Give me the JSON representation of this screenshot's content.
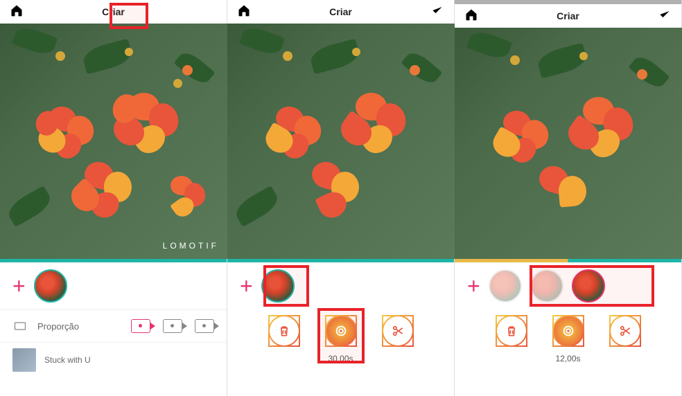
{
  "panels": [
    {
      "title": "Criar",
      "right_action": "download",
      "watermark": "LOMOTIF",
      "progress_style": "teal",
      "clips": [
        {
          "style": "teal"
        }
      ],
      "options": {
        "aspect_label": "Proporção",
        "music_title": "Stuck with U"
      }
    },
    {
      "title": "Criar",
      "right_action": "check",
      "progress_style": "teal",
      "clips": [
        {
          "style": "teal",
          "highlighted": true
        }
      ],
      "duration": "30,00s",
      "tools": [
        "trash",
        "duplicate",
        "scissors"
      ],
      "highlight_duplicate": true
    },
    {
      "title": "Criar",
      "right_action": "check",
      "progress_style": "yellow",
      "clips": [
        {
          "style": "faded"
        },
        {
          "style": "faded"
        },
        {
          "style": "magenta"
        }
      ],
      "clips_highlighted": true,
      "duration": "12,00s",
      "tools": [
        "trash",
        "duplicate",
        "scissors"
      ]
    }
  ]
}
